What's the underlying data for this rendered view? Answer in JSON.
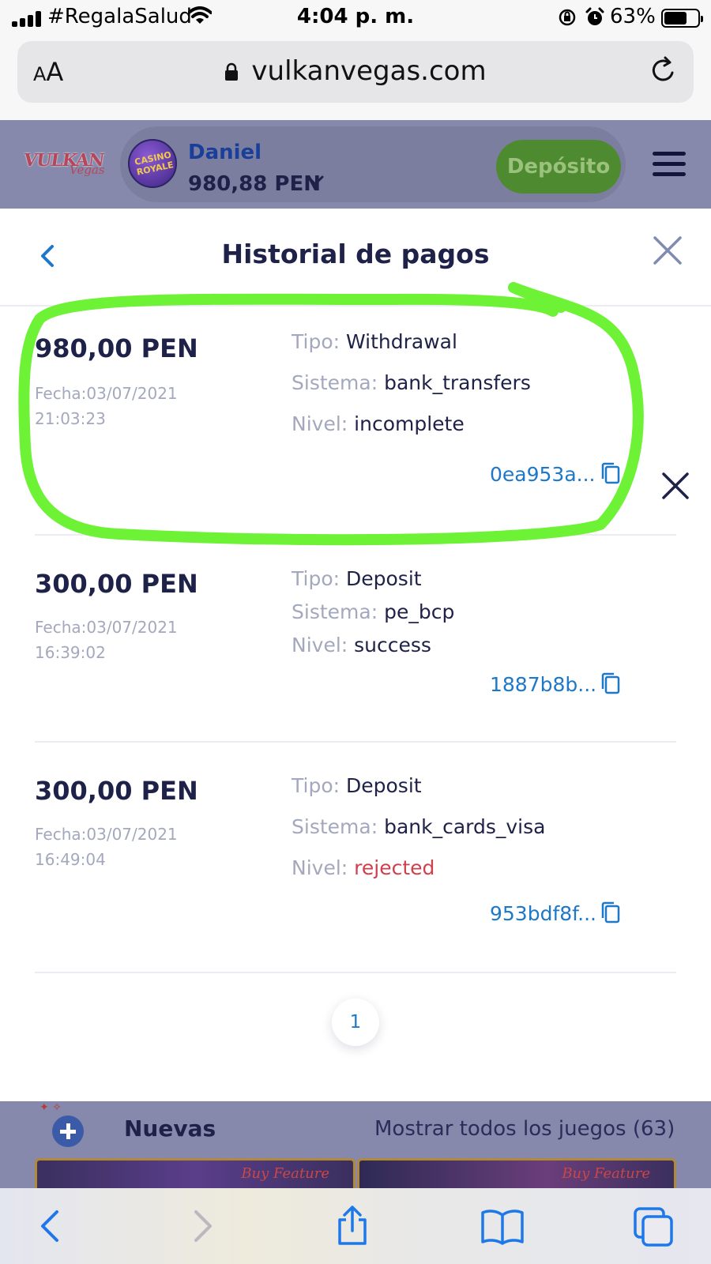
{
  "status_bar": {
    "carrier": "#RegalaSalud",
    "time": "4:04 p. m.",
    "battery_percent": "63%",
    "battery_level": 0.63,
    "icons": [
      "signal-icon",
      "wifi-icon",
      "rotation-lock-icon",
      "alarm-icon",
      "battery-icon"
    ]
  },
  "browser": {
    "text_size_button": "AA",
    "url": "vulkanvegas.com",
    "icons": [
      "lock-icon",
      "reload-icon"
    ]
  },
  "site_header": {
    "logo_word": "VULKAN",
    "logo_script": "Vegas",
    "badge_text": "CASINO ROYALE",
    "user_name": "Daniel",
    "balance": "980,88 PEN",
    "deposit_button": "Depósito",
    "icons": [
      "casino-royale-badge-icon",
      "chevron-down-icon",
      "hamburger-menu-icon"
    ]
  },
  "modal": {
    "title": "Historial de pagos",
    "labels": {
      "tipo": "Tipo:",
      "sistema": "Sistema:",
      "nivel": "Nivel:"
    },
    "transactions": [
      {
        "amount": "980,00 PEN",
        "date_line1": "Fecha:03/07/2021",
        "date_line2": "21:03:23",
        "tipo": "Withdrawal",
        "sistema": "bank_transfers",
        "nivel": "incomplete",
        "txid": "0ea953a...",
        "cancellable": true
      },
      {
        "amount": "300,00 PEN",
        "date_line1": "Fecha:03/07/2021",
        "date_line2": "16:39:02",
        "tipo": "Deposit",
        "sistema": "pe_bcp",
        "nivel": "success",
        "txid": "1887b8b..."
      },
      {
        "amount": "300,00 PEN",
        "date_line1": "Fecha:03/07/2021",
        "date_line2": "16:49:04",
        "tipo": "Deposit",
        "sistema": "bank_cards_visa",
        "nivel": "rejected",
        "txid": "953bdf8f..."
      }
    ],
    "pagination": {
      "current_page": "1"
    },
    "colors": {
      "txid": "#1e78c8",
      "rejected": "#d0404c",
      "highlight_annotation": "#6df235"
    }
  },
  "games_section": {
    "title": "Nuevas",
    "show_all": "Mostrar todos los juegos (63)",
    "thumb_labels": [
      "Buy Feature",
      "Buy Feature"
    ]
  },
  "toolbar": {
    "icons": [
      "back-arrow-icon",
      "forward-arrow-icon",
      "share-icon",
      "bookmarks-icon",
      "tabs-icon"
    ]
  }
}
